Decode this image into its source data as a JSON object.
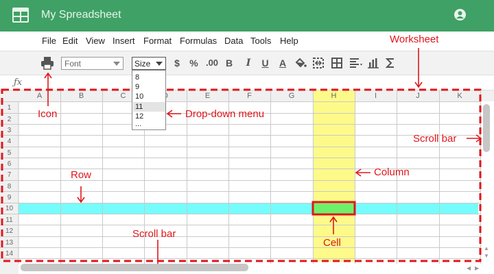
{
  "header": {
    "title": "My Spreadsheet",
    "colors": {
      "brand": "#3fa165",
      "title_text": "#e8f5ec"
    }
  },
  "menu": {
    "items": [
      "File",
      "Edit",
      "View",
      "Insert",
      "Format",
      "Formulas",
      "Data",
      "Tools",
      "Help"
    ]
  },
  "toolbar": {
    "font_value": "Font",
    "size_value": "Size",
    "currency": "$",
    "percent": "%",
    "decimals": ".00",
    "bold": "B",
    "italic": "I",
    "underline": "U",
    "text_color": "A",
    "icons": [
      "print-icon",
      "paint-bucket-icon",
      "merge-cells-icon",
      "borders-icon",
      "align-icon",
      "chart-icon",
      "sum-icon"
    ]
  },
  "size_dropdown": {
    "options": [
      "8",
      "9",
      "10",
      "11",
      "12",
      "..."
    ],
    "highlighted": "11"
  },
  "formula_bar": {
    "label": "ƒx"
  },
  "sheet": {
    "columns": [
      "A",
      "B",
      "C",
      "D",
      "E",
      "F",
      "G",
      "H",
      "I",
      "J",
      "K"
    ],
    "rows": [
      "1",
      "2",
      "3",
      "4",
      "5",
      "6",
      "7",
      "8",
      "9",
      "10",
      "11",
      "12",
      "13",
      "14"
    ],
    "selected_column": "H",
    "selected_row": "9",
    "selected_cell": "H9",
    "colors": {
      "column_highlight": "#fdfa8a",
      "row_highlight": "#76fcfc",
      "cell_highlight": "#6ff06b",
      "annotation": "#e0161b"
    }
  },
  "annotations": {
    "worksheet": "Worksheet",
    "icon": "Icon",
    "dropdown": "Drop-down menu",
    "scroll_bar_v": "Scroll bar",
    "row": "Row",
    "column": "Column",
    "scroll_bar_h": "Scroll bar",
    "cell": "Cell"
  }
}
